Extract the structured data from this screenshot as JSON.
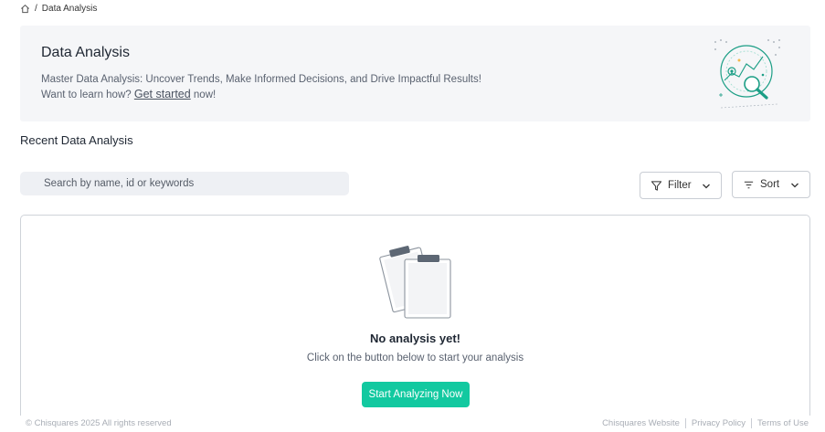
{
  "breadcrumb": {
    "separator": "/",
    "current": "Data Analysis"
  },
  "banner": {
    "title": "Data Analysis",
    "description": "Master Data Analysis: Uncover Trends, Make Informed Decisions, and Drive Impactful Results! Want to learn how?",
    "link_label": "Get started",
    "suffix": "now!",
    "illustration_icon": "magnifier-chart-icon"
  },
  "section": {
    "title": "Recent Data Analysis"
  },
  "search": {
    "placeholder": "Search by name, id or keywords",
    "value": ""
  },
  "filter": {
    "label": "Filter",
    "icon": "filter-icon"
  },
  "sort": {
    "label": "Sort",
    "icon": "sort-lines-icon"
  },
  "empty_state": {
    "title": "No analysis yet!",
    "subtitle": "Click on the button below to start your analysis",
    "button_label": "Start Analyzing Now",
    "illustration_icon": "clipboards-icon"
  },
  "footer": {
    "copyright": "© Chisquares 2025 All rights reserved",
    "links": [
      "Chisquares Website",
      "Privacy Policy",
      "Terms of Use"
    ]
  },
  "colors": {
    "accent": "#12c9a0",
    "banner_bg": "#f5f6f8",
    "search_bg": "#eef0f4"
  }
}
